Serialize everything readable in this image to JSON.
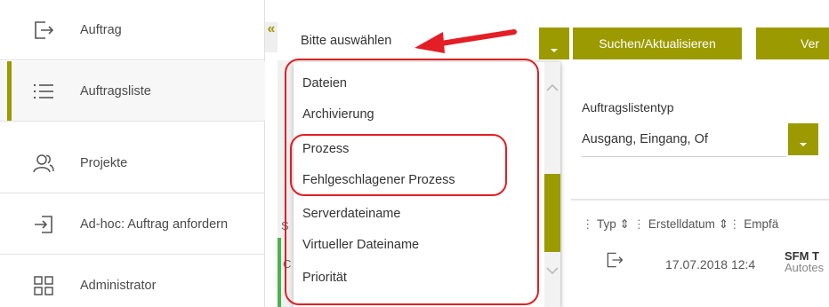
{
  "sidebar": {
    "items": [
      {
        "label": "Auftrag",
        "icon": "logout-arrow-icon",
        "active": false
      },
      {
        "label": "Auftragsliste",
        "icon": "list-icon",
        "active": true
      },
      {
        "label": "Projekte",
        "icon": "users-icon",
        "active": false
      },
      {
        "label": "Ad-hoc: Auftrag anfordern",
        "icon": "login-arrow-icon",
        "active": false
      },
      {
        "label": "Administrator",
        "icon": "grid-icon",
        "active": false
      }
    ],
    "collapse_symbol": "«"
  },
  "toolbar": {
    "select_label": "Bitte auswählen",
    "search_button": "Suchen/Aktualisieren",
    "next_button": "Ver"
  },
  "filter": {
    "label": "Auftragslistentyp",
    "value": "Ausgang, Eingang, Of"
  },
  "dropdown": {
    "options": [
      "Dateien",
      "Archivierung",
      "Prozess",
      "Fehlgeschlagener Prozess",
      "Serverdateiname",
      "Virtueller Dateiname",
      "Priorität"
    ]
  },
  "table": {
    "header_typ": "Typ",
    "header_date": "Erstelldatum",
    "header_recv": "Empfä",
    "row": {
      "icon": "logout-arrow-icon",
      "date": "17.07.2018 12:4",
      "recv_top": "SFM T",
      "recv_bottom": "Autotes"
    }
  },
  "behind": {
    "letter_s": "S",
    "letter_c": "C"
  },
  "colors": {
    "accent": "#9b9a00",
    "annotation": "#e31e24",
    "status": "#49b24a"
  }
}
